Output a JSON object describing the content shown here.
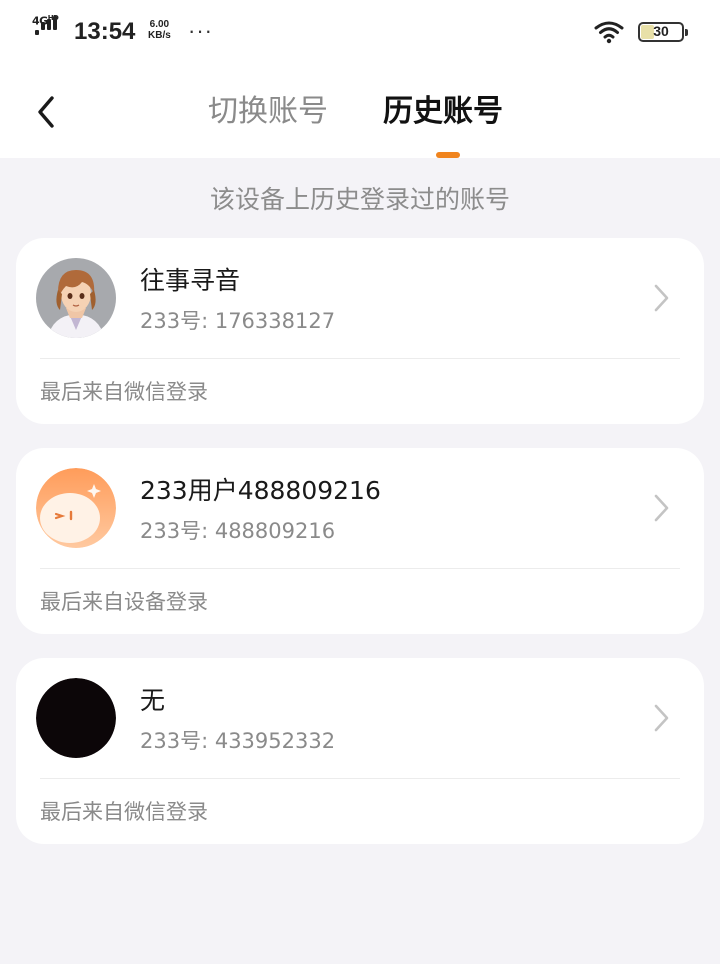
{
  "status_bar": {
    "network": "4G",
    "network_sup": "HD",
    "time": "13:54",
    "speed_value": "6.00",
    "speed_unit": "KB/s",
    "more": "···",
    "battery": "30",
    "battery_level": 0.3
  },
  "header": {
    "back_icon": "chevron-left-icon",
    "tabs": [
      {
        "label": "切换账号",
        "active": false
      },
      {
        "label": "历史账号",
        "active": true
      }
    ],
    "accent": "#f0841e"
  },
  "subtitle": "该设备上历史登录过的账号",
  "accounts": [
    {
      "name": "往事寻音",
      "uid": "233号: 176338127",
      "login_source": "最后来自微信登录",
      "avatar": "anime-character-avatar"
    },
    {
      "name": "233用户488809216",
      "uid": "233号: 488809216",
      "login_source": "最后来自设备登录",
      "avatar": "orange-mascot-avatar"
    },
    {
      "name": "无",
      "uid": "233号: 433952332",
      "login_source": "最后来自微信登录",
      "avatar": "black-avatar"
    }
  ]
}
